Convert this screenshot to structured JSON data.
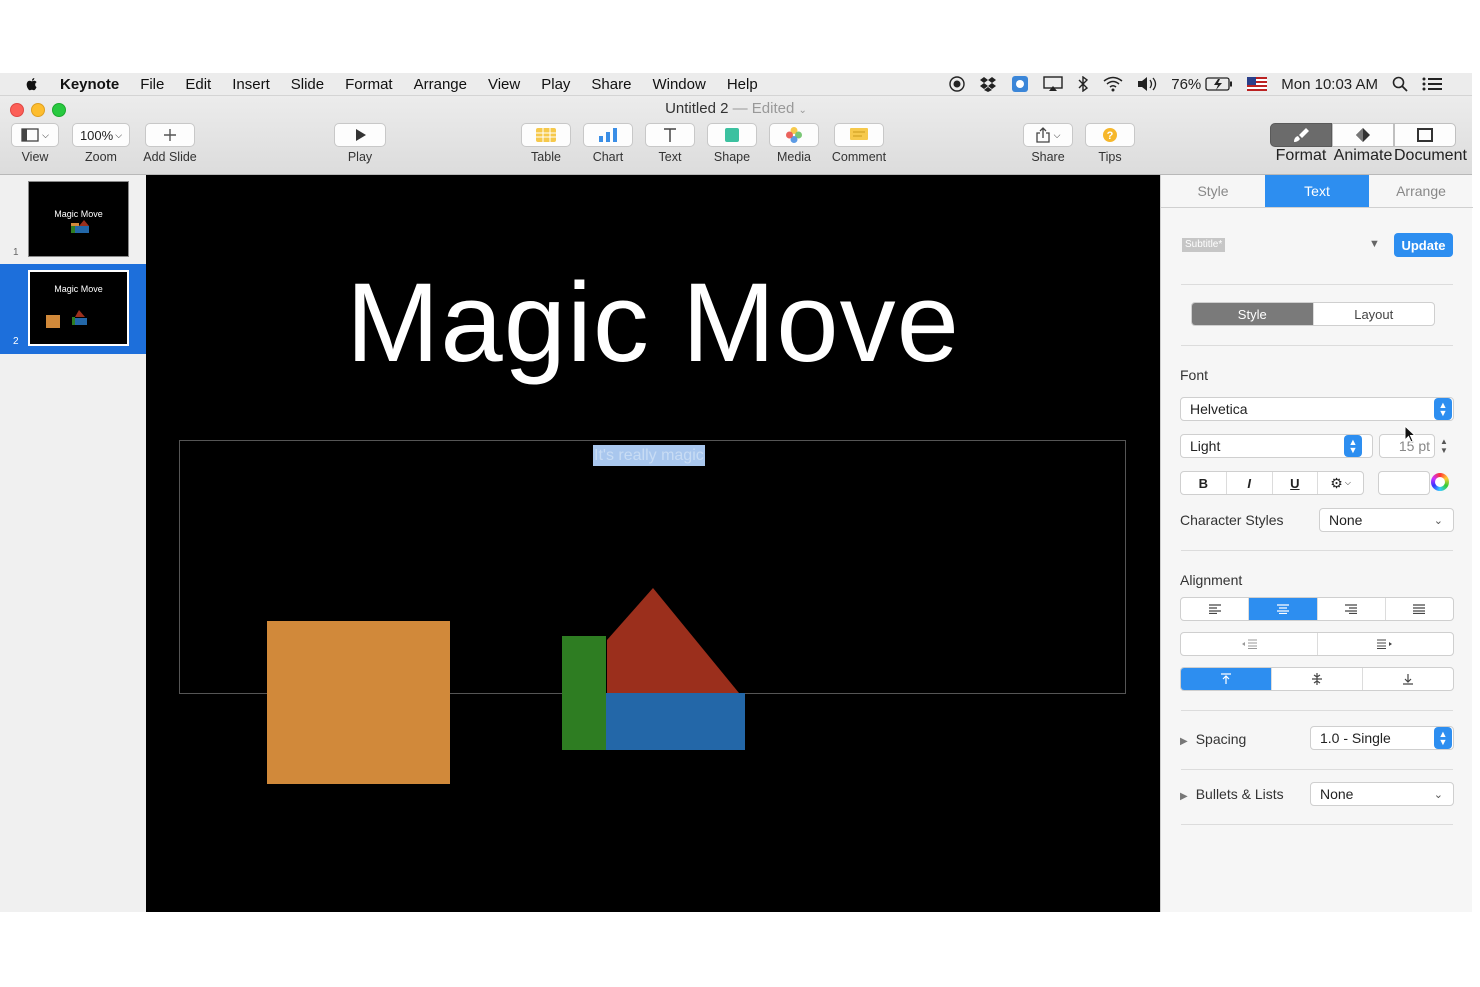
{
  "menubar": {
    "items": [
      "Keynote",
      "File",
      "Edit",
      "Insert",
      "Slide",
      "Format",
      "Arrange",
      "View",
      "Play",
      "Share",
      "Window",
      "Help"
    ],
    "battery": "76%",
    "clock": "Mon 10:03 AM"
  },
  "window": {
    "title": "Untitled 2",
    "separator": "—",
    "edited": "Edited"
  },
  "toolbar": {
    "view_label": "View",
    "zoom_value": "100%",
    "zoom_label": "Zoom",
    "add_slide_label": "Add Slide",
    "play_label": "Play",
    "table_label": "Table",
    "chart_label": "Chart",
    "text_label": "Text",
    "shape_label": "Shape",
    "media_label": "Media",
    "comment_label": "Comment",
    "share_label": "Share",
    "tips_label": "Tips",
    "format_label": "Format",
    "animate_label": "Animate",
    "document_label": "Document"
  },
  "navigator": {
    "slides": [
      {
        "number": "1",
        "title": "Magic Move"
      },
      {
        "number": "2",
        "title": "Magic Move"
      }
    ]
  },
  "slide": {
    "title": "Magic Move",
    "subtitle": "It's really magic"
  },
  "inspector": {
    "tabs": [
      "Style",
      "Text",
      "Arrange"
    ],
    "active_tab": "Text",
    "paragraph_style": "Subtitle*",
    "update_label": "Update",
    "subtabs": [
      "Style",
      "Layout"
    ],
    "font_section": "Font",
    "font_family": "Helvetica",
    "font_weight": "Light",
    "font_size": "15 pt",
    "bold": "B",
    "italic": "I",
    "underline": "U",
    "character_styles_label": "Character Styles",
    "character_styles_value": "None",
    "alignment_section": "Alignment",
    "spacing_label": "Spacing",
    "spacing_value": "1.0 - Single",
    "bullets_label": "Bullets & Lists",
    "bullets_value": "None"
  },
  "colors": {
    "accent": "#2d8ef0",
    "orange_shape": "#d1893a",
    "red_shape": "#9b2f1c",
    "green_shape": "#2e7d22",
    "blue_shape": "#2367a8"
  }
}
